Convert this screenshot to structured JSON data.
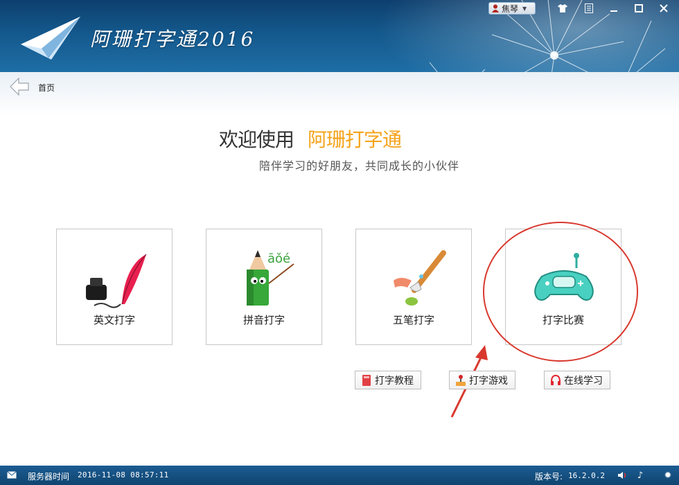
{
  "window": {
    "title": "阿珊打字通2016",
    "user_name": "焦琴",
    "controls": [
      "shirt-icon",
      "list-icon",
      "minimize-icon",
      "maximize-icon",
      "close-icon"
    ]
  },
  "nav": {
    "home_label": "首页"
  },
  "welcome": {
    "prefix": "欢迎使用",
    "brand": "阿珊打字通",
    "subtitle": "陪伴学习的好朋友，共同成长的小伙伴",
    "brand_color": "#f5a31a"
  },
  "modules": [
    {
      "label": "英文打字",
      "icon": "ink-quill-icon"
    },
    {
      "label": "拼音打字",
      "icon": "pencil-mascot-icon",
      "letters": "āǒé"
    },
    {
      "label": "五笔打字",
      "icon": "paintbrush-icon"
    },
    {
      "label": "打字比赛",
      "icon": "game-controller-icon"
    }
  ],
  "links": [
    {
      "label": "打字教程",
      "icon": "book-icon"
    },
    {
      "label": "打字游戏",
      "icon": "joystick-icon"
    },
    {
      "label": "在线学习",
      "icon": "headset-icon"
    }
  ],
  "status": {
    "server_time_label": "服务器时间",
    "server_time": "2016-11-08 08:57:11",
    "version_label": "版本号:",
    "version": "16.2.0.2"
  },
  "annotation_color": "#d9382e"
}
